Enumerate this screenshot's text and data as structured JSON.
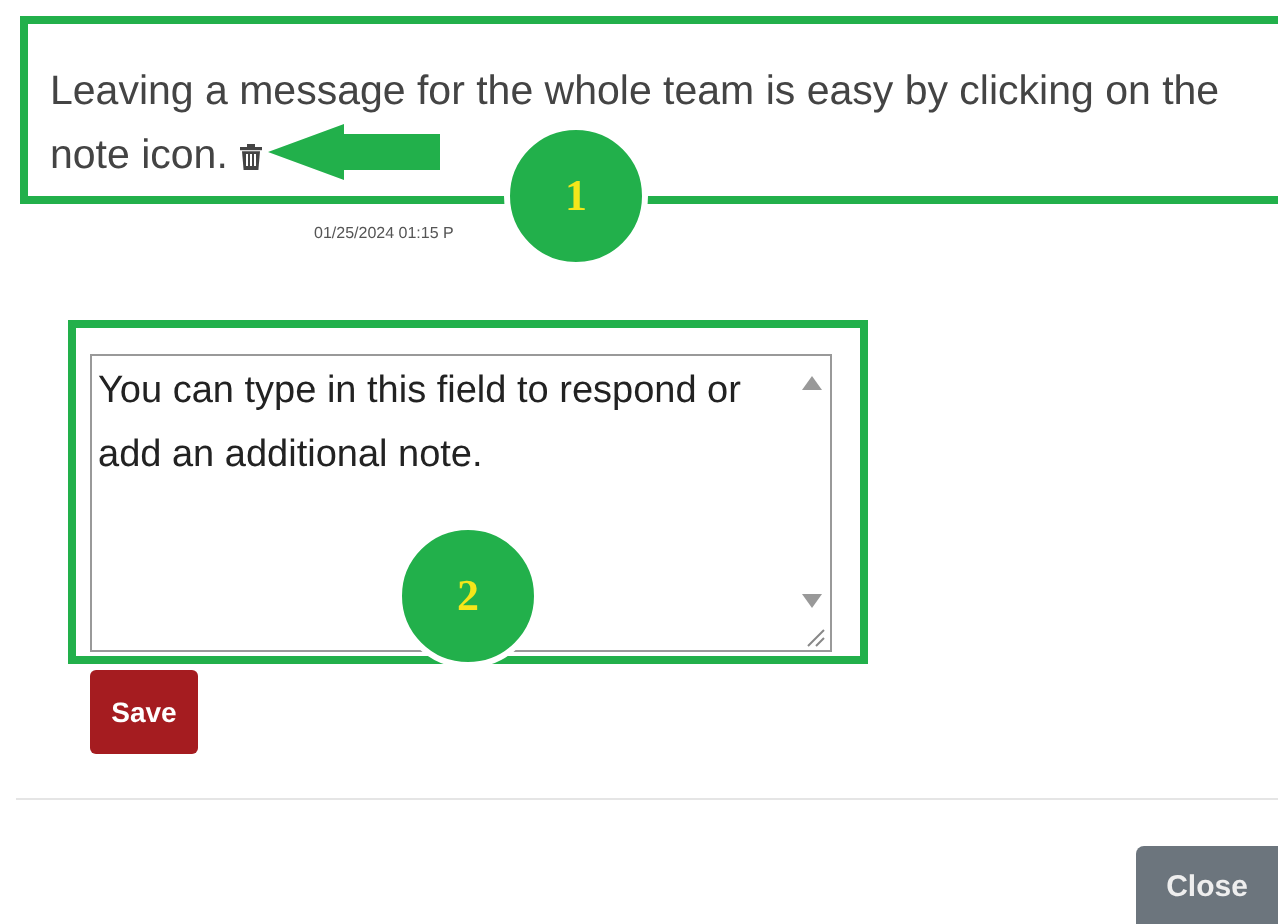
{
  "note": {
    "text": "Leaving a message for the whole team is easy by clicking on the note icon.",
    "timestamp": "01/25/2024 01:15 P"
  },
  "reply": {
    "value": "You can type in this field to respond or add an additional note."
  },
  "save_button": "Save",
  "close_button": "Close",
  "callouts": [
    {
      "number": "1"
    },
    {
      "number": "2"
    }
  ]
}
